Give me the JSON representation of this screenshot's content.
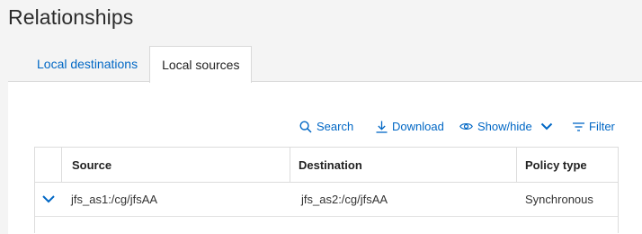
{
  "page": {
    "title": "Relationships"
  },
  "tabs": [
    {
      "label": "Local destinations",
      "active": false
    },
    {
      "label": "Local sources",
      "active": true
    }
  ],
  "toolbar": {
    "search_label": "Search",
    "download_label": "Download",
    "showhide_label": "Show/hide",
    "filter_label": "Filter"
  },
  "table": {
    "columns": [
      "Source",
      "Destination",
      "Policy type"
    ],
    "rows": [
      {
        "source": "jfs_as1:/cg/jfsAA",
        "destination": "jfs_as2:/cg/jfsAA",
        "policy_type": "Synchronous"
      }
    ]
  },
  "colors": {
    "accent": "#0067c5",
    "border": "#dcdcdc",
    "background": "#f4f4f4"
  },
  "icons": [
    "search-icon",
    "download-icon",
    "eye-icon",
    "chevron-down-icon",
    "filter-icon",
    "expand-chevron-icon"
  ]
}
